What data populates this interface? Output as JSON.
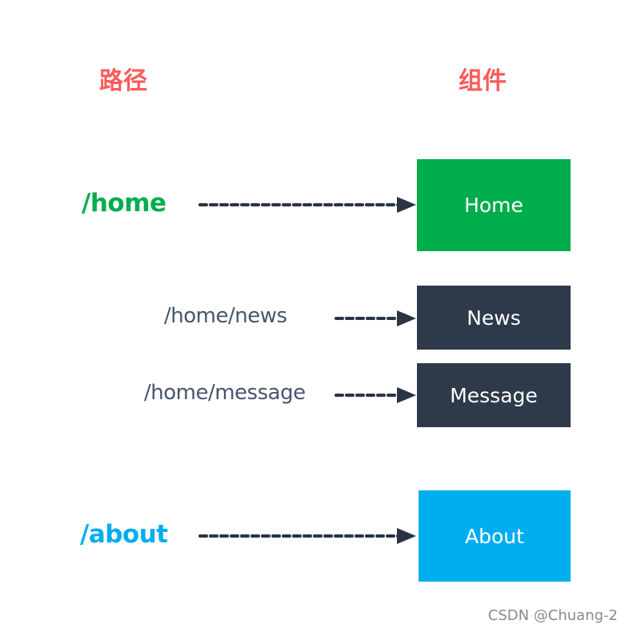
{
  "headers": {
    "path": "路径",
    "component": "组件"
  },
  "colors": {
    "header": "#fc5a5a",
    "home": "#00ad4d",
    "child": "#2e394a",
    "about": "#00aeef",
    "child_path_text": "#46556d",
    "arrow": "#2a3444"
  },
  "routes": [
    {
      "path": "/home",
      "component": "Home",
      "level": "top"
    },
    {
      "path": "/home/news",
      "component": "News",
      "level": "child"
    },
    {
      "path": "/home/message",
      "component": "Message",
      "level": "child"
    },
    {
      "path": "/about",
      "component": "About",
      "level": "top"
    }
  ],
  "watermark": "CSDN @Chuang-2"
}
